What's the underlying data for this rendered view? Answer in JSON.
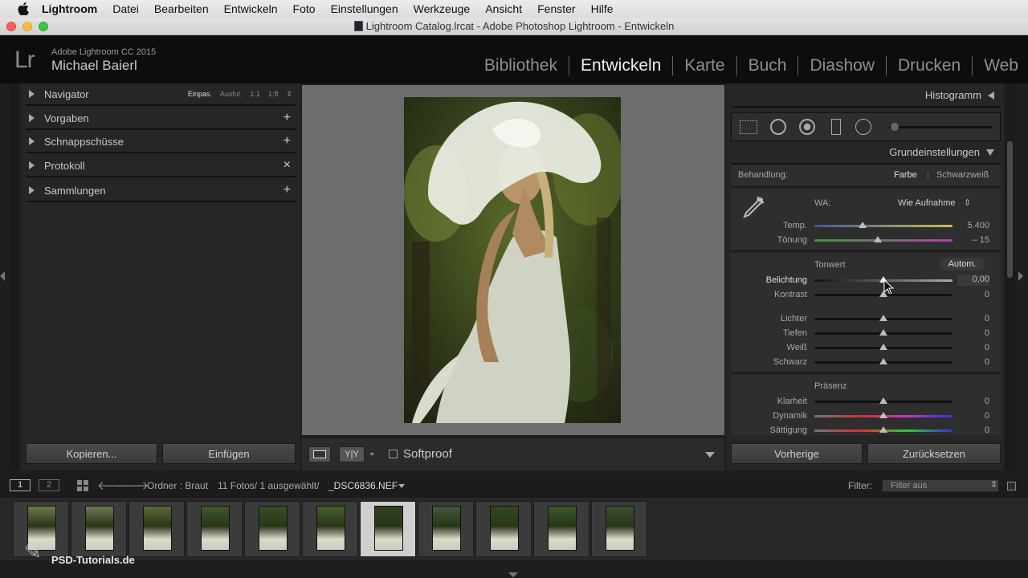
{
  "menubar": {
    "items": [
      "Lightroom",
      "Datei",
      "Bearbeiten",
      "Entwickeln",
      "Foto",
      "Einstellungen",
      "Werkzeuge",
      "Ansicht",
      "Fenster",
      "Hilfe"
    ]
  },
  "window": {
    "title": "Lightroom Catalog.lrcat - Adobe Photoshop Lightroom - Entwickeln"
  },
  "identity": {
    "logo": "Lr",
    "version": "Adobe Lightroom CC 2015",
    "user": "Michael Baierl"
  },
  "modules": [
    {
      "label": "Bibliothek"
    },
    {
      "label": "Entwickeln",
      "active": true
    },
    {
      "label": "Karte"
    },
    {
      "label": "Buch"
    },
    {
      "label": "Diashow"
    },
    {
      "label": "Drucken"
    },
    {
      "label": "Web"
    }
  ],
  "left_panel": {
    "navigator": {
      "label": "Navigator",
      "zoom": [
        "Einpas.",
        "Ausful.",
        "1:1",
        "1:8"
      ]
    },
    "sections": [
      {
        "label": "Vorgaben",
        "action": "+"
      },
      {
        "label": "Schnappschüsse",
        "action": "+"
      },
      {
        "label": "Protokoll",
        "action": "×"
      },
      {
        "label": "Sammlungen",
        "action": "+"
      }
    ],
    "copy_button": "Kopieren...",
    "paste_button": "Einfügen"
  },
  "toolbar": {
    "view_icon": "loupe-view-icon",
    "compare_label": "Y|Y",
    "softproof_label": "Softproof",
    "softproof_checked": false
  },
  "right_panel": {
    "histogram_label": "Histogramm",
    "basic_label": "Grundeinstellungen",
    "treatment": {
      "label": "Behandlung:",
      "color": "Farbe",
      "bw": "Schwarzweiß"
    },
    "wb": {
      "label": "WA:",
      "value": "Wie Aufnahme"
    },
    "temp": {
      "label": "Temp.",
      "value": "5.400",
      "pos": 0.35
    },
    "tint": {
      "label": "Tönung",
      "value": "– 15",
      "pos": 0.46
    },
    "tone_label": "Tonwert",
    "auto_label": "Autom.",
    "exposure": {
      "label": "Belichtung",
      "value": "0,00",
      "pos": 0.5
    },
    "contrast": {
      "label": "Kontrast",
      "value": "0",
      "pos": 0.5
    },
    "highlights": {
      "label": "Lichter",
      "value": "0",
      "pos": 0.5
    },
    "shadows": {
      "label": "Tiefen",
      "value": "0",
      "pos": 0.5
    },
    "whites": {
      "label": "Weiß",
      "value": "0",
      "pos": 0.5
    },
    "blacks": {
      "label": "Schwarz",
      "value": "0",
      "pos": 0.5
    },
    "presence_label": "Präsenz",
    "clarity": {
      "label": "Klarheit",
      "value": "0",
      "pos": 0.5
    },
    "vibrance": {
      "label": "Dynamik",
      "value": "0",
      "pos": 0.5
    },
    "saturation": {
      "label": "Sättigung",
      "value": "0",
      "pos": 0.5
    },
    "prev_button": "Vorherige",
    "reset_button": "Zurücksetzen"
  },
  "filmbar": {
    "page1": "1",
    "page2": "2",
    "source": "Ordner : Braut",
    "count": "11 Fotos/ 1 ausgewählt/",
    "filename": "_DSC6836.NEF",
    "filter_label": "Filter:",
    "filter_value": "Filter aus"
  },
  "filmstrip": {
    "thumbnails": 11,
    "selected_index": 6
  },
  "watermark": "PSD-Tutorials.de"
}
